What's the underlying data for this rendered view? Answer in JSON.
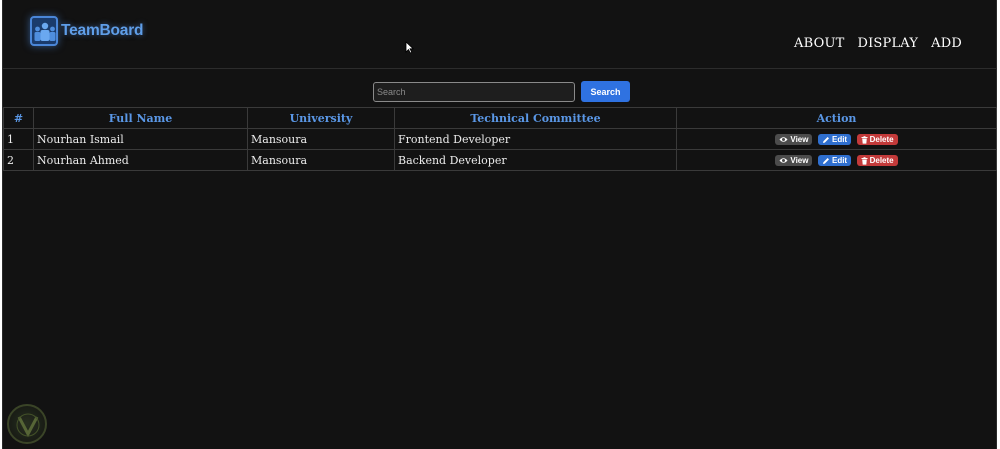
{
  "brand": {
    "name": "TeamBoard"
  },
  "nav": {
    "about": "ABOUT",
    "display": "DISPLAY",
    "add": "ADD"
  },
  "search": {
    "placeholder": "Search",
    "value": "",
    "button_label": "Search"
  },
  "table": {
    "headers": [
      "#",
      "Full Name",
      "University",
      "Technical Committee",
      "Action"
    ],
    "rows": [
      {
        "num": "1",
        "name": "Nourhan Ismail",
        "university": "Mansoura",
        "committee": "Frontend Developer"
      },
      {
        "num": "2",
        "name": "Nourhan Ahmed",
        "university": "Mansoura",
        "committee": "Backend Developer"
      }
    ],
    "actions": {
      "view": "View",
      "edit": "Edit",
      "delete": "Delete"
    }
  },
  "colors": {
    "background": "#121212",
    "accent": "#2f72e1",
    "header_text": "#5a97e6",
    "delete": "#c33a3a",
    "view": "#4c4c4c"
  },
  "icons": {
    "logo": "team-icon",
    "view": "eye-icon",
    "edit": "pencil-icon",
    "delete": "trash-icon"
  }
}
